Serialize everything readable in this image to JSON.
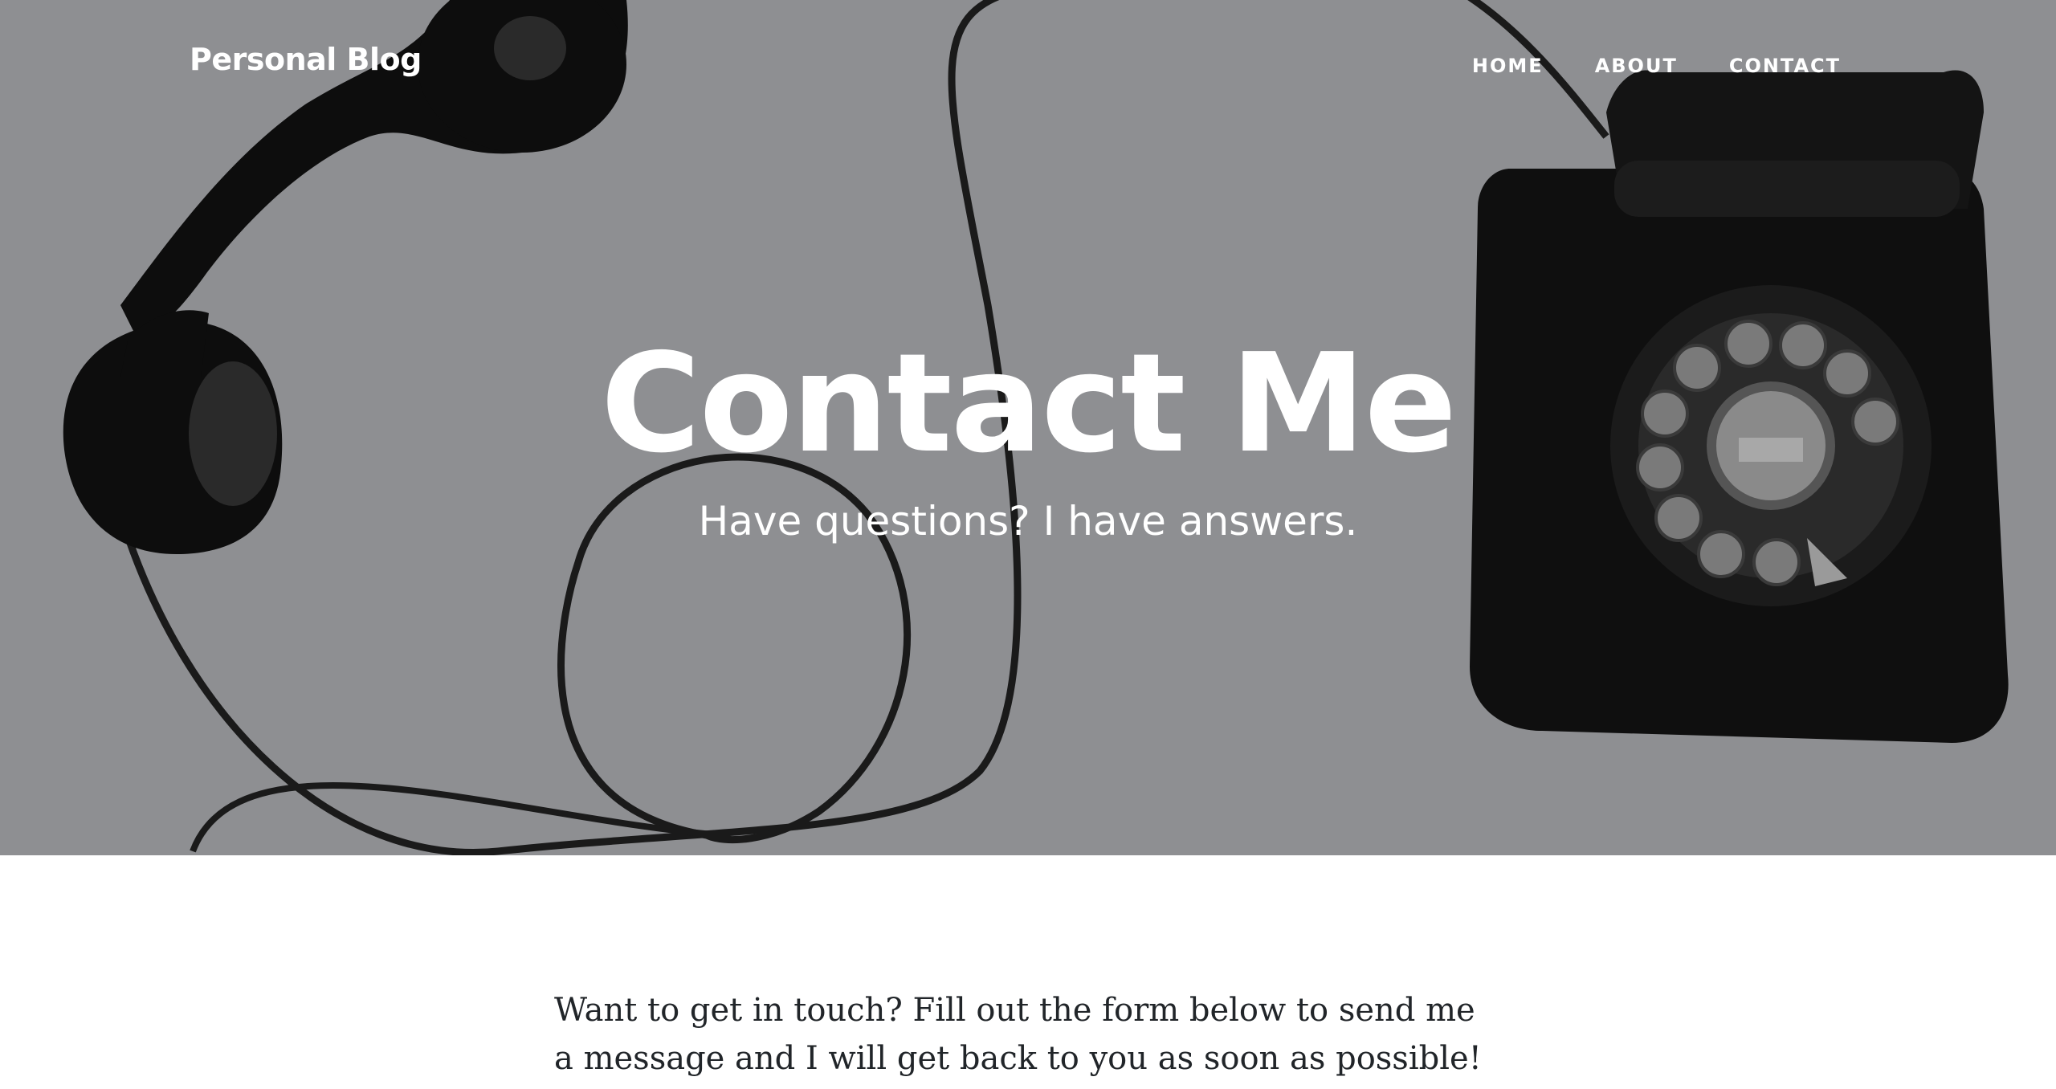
{
  "navbar": {
    "brand": "Personal Blog",
    "links": [
      {
        "label": "HOME"
      },
      {
        "label": "ABOUT"
      },
      {
        "label": "CONTACT"
      }
    ]
  },
  "hero": {
    "title": "Contact Me",
    "subtitle": "Have questions? I have answers.",
    "background_image": "rotary-telephone-photo",
    "overlay_color": "#8e8f92"
  },
  "content": {
    "intro": "Want to get in touch? Fill out the form below to send me a message and I will get back to you as soon as possible!"
  },
  "colors": {
    "hero_text": "#ffffff",
    "body_text": "#212529",
    "page_background": "#ffffff"
  }
}
